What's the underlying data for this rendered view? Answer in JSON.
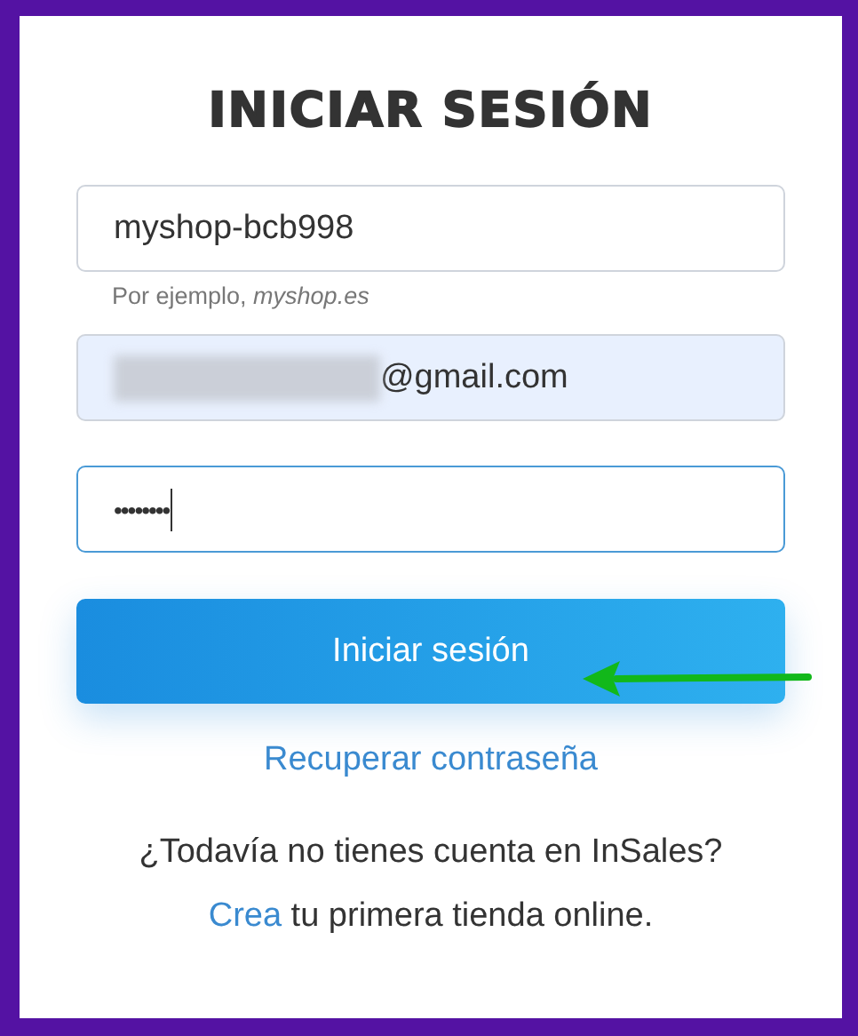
{
  "title": "INICIAR SESIÓN",
  "fields": [
    {
      "kind": "text",
      "value": "myshop-bcb998",
      "hint": "Por ejemplo, *myshop.es*",
      "focused": false,
      "autofilled": false
    },
    {
      "kind": "email",
      "value": "@gmail.com",
      "focused": false,
      "autofilled": true,
      "redacted": true
    },
    {
      "kind": "password",
      "value": "••••••••",
      "focused": true,
      "autofilled": false
    }
  ],
  "submit_button": "Iniciar sesión",
  "recover_link": "Recuperar contraseña",
  "signup_question": "¿Todavía no tienes cuenta en InSales?",
  "signup": {
    "link": "Crea",
    "text": "tu primera tienda online."
  }
}
